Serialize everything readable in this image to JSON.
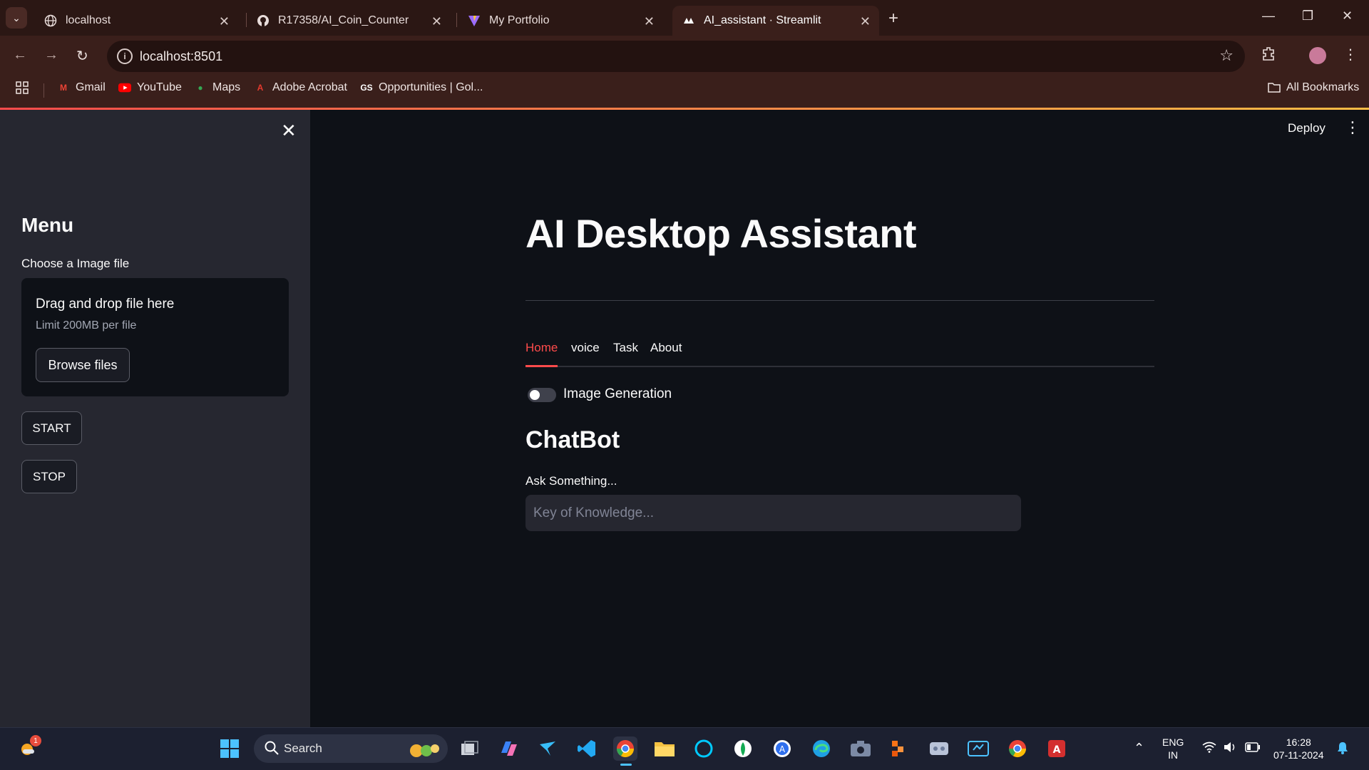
{
  "browser": {
    "tabs": [
      {
        "title": "localhost",
        "icon": "globe-icon"
      },
      {
        "title": "R17358/AI_Coin_Counter",
        "icon": "github-icon"
      },
      {
        "title": "My Portfolio",
        "icon": "vite-icon"
      },
      {
        "title": "AI_assistant · Streamlit",
        "icon": "streamlit-icon"
      }
    ],
    "url": "localhost:8501",
    "bookmarks": [
      {
        "label": "Gmail"
      },
      {
        "label": "YouTube"
      },
      {
        "label": "Maps"
      },
      {
        "label": "Adobe Acrobat"
      },
      {
        "label": "Opportunities | Gol..."
      }
    ],
    "all_bookmarks": "All Bookmarks"
  },
  "sidebar": {
    "title": "Menu",
    "uploader_label": "Choose a Image file",
    "dropzone_title": "Drag and drop file here",
    "dropzone_limit": "Limit 200MB per file",
    "browse_label": "Browse files",
    "start_label": "START",
    "stop_label": "STOP"
  },
  "header": {
    "deploy_label": "Deploy"
  },
  "main": {
    "title": "AI Desktop Assistant",
    "tabs": [
      {
        "label": "Home",
        "active": true
      },
      {
        "label": "voice",
        "active": false
      },
      {
        "label": "Task",
        "active": false
      },
      {
        "label": "About",
        "active": false
      }
    ],
    "toggle_label": "Image Generation",
    "toggle_on": false,
    "section_title": "ChatBot",
    "input_label": "Ask Something...",
    "input_placeholder": "Key of Knowledge...",
    "input_value": ""
  },
  "taskbar": {
    "search_label": "Search",
    "lang_line1": "ENG",
    "lang_line2": "IN",
    "time": "16:28",
    "date": "07-11-2024",
    "weather_badge": "1"
  },
  "colors": {
    "accent": "#ff4b4b",
    "app_bg": "#0e1117",
    "sidebar_bg": "#262730",
    "browser_chrome": "#3a1f1b"
  }
}
